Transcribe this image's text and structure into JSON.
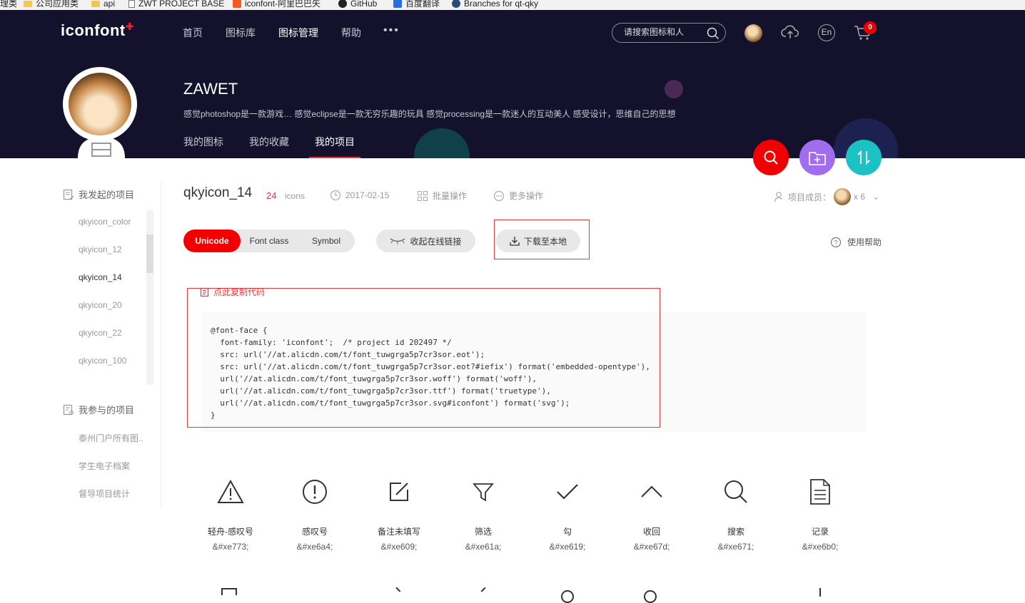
{
  "bookmarks": [
    {
      "label": "理类",
      "icon": "folder-icon"
    },
    {
      "label": "公司应用类",
      "icon": "folder-icon"
    },
    {
      "label": "api",
      "icon": "folder-icon"
    },
    {
      "label": "ZWT PROJECT BASE",
      "icon": "page-icon"
    },
    {
      "label": "iconfont-阿里巴巴矢",
      "icon": "iconfont-icon"
    },
    {
      "label": "GitHub",
      "icon": "github-icon"
    },
    {
      "label": "百度翻译",
      "icon": "baidu-icon"
    },
    {
      "label": "Branches for qt-qky",
      "icon": "branch-icon"
    }
  ],
  "header": {
    "logo": "iconfont",
    "nav": [
      "首页",
      "图标库",
      "图标管理",
      "帮助"
    ],
    "nav_active": "图标管理",
    "nav_more": "•••",
    "search_placeholder": "请搜索图标和人",
    "lang_label": "En",
    "cart_count": "0"
  },
  "profile": {
    "username": "ZAWET",
    "bio": "感觉photoshop是一款游戏… 感觉eclipse是一款无穷乐趣的玩具 感觉processing是一款迷人的互动美人 感受设计，思维自己的思想",
    "tabs": [
      "我的图标",
      "我的收藏",
      "我的项目"
    ],
    "active_tab": "我的项目"
  },
  "sidebar": {
    "started_heading": "我发起的项目",
    "started_projects": [
      "qkyicon_color",
      "qkyicon_12",
      "qkyicon_14",
      "qkyicon_20",
      "qkyicon_22",
      "qkyicon_100"
    ],
    "active_project": "qkyicon_14",
    "joined_heading": "我参与的项目",
    "joined_projects": [
      "泰州门户所有图..",
      "学生电子档案",
      "督导项目统计"
    ]
  },
  "project": {
    "name": "qkyicon_14",
    "icon_count": "24",
    "icon_unit": "icons",
    "date": "2017-02-15",
    "batch_label": "批量操作",
    "more_label": "更多操作",
    "members_label": "项目成员：",
    "members_count": "x 6"
  },
  "toolbar": {
    "modes": [
      "Unicode",
      "Font class",
      "Symbol"
    ],
    "active_mode": "Unicode",
    "collapse_label": "收起在线链接",
    "download_label": "下载至本地",
    "help_label": "使用帮助",
    "copy_label": "点此复制代码"
  },
  "code_lines": [
    "@font-face {",
    "  font-family: 'iconfont';  /* project id 202497 */",
    "  src: url('//at.alicdn.com/t/font_tuwgrga5p7cr3sor.eot');",
    "  src: url('//at.alicdn.com/t/font_tuwgrga5p7cr3sor.eot?#iefix') format('embedded-opentype'),",
    "  url('//at.alicdn.com/t/font_tuwgrga5p7cr3sor.woff') format('woff'),",
    "  url('//at.alicdn.com/t/font_tuwgrga5p7cr3sor.ttf') format('truetype'),",
    "  url('//at.alicdn.com/t/font_tuwgrga5p7cr3sor.svg#iconfont') format('svg');",
    "}"
  ],
  "icons": [
    {
      "name": "轻舟-感叹号",
      "code": "&#xe773;",
      "icon": "warning-triangle-icon"
    },
    {
      "name": "感叹号",
      "code": "&#xe6a4;",
      "icon": "exclamation-circle-icon"
    },
    {
      "name": "备注未填写",
      "code": "&#xe609;",
      "icon": "edit-note-icon"
    },
    {
      "name": "筛选",
      "code": "&#xe61a;",
      "icon": "filter-icon"
    },
    {
      "name": "勾",
      "code": "&#xe619;",
      "icon": "check-icon"
    },
    {
      "name": "收回",
      "code": "&#xe67d;",
      "icon": "chevron-up-icon"
    },
    {
      "name": "搜索",
      "code": "&#xe671;",
      "icon": "search-icon"
    },
    {
      "name": "记录",
      "code": "&#xe6b0;",
      "icon": "document-icon"
    }
  ],
  "colors": {
    "banner_bg": "#13112b",
    "accent_red": "#f00000",
    "fab_search": "#f00000",
    "fab_folder": "#a06cf0",
    "fab_sort": "#1cc1c4"
  }
}
